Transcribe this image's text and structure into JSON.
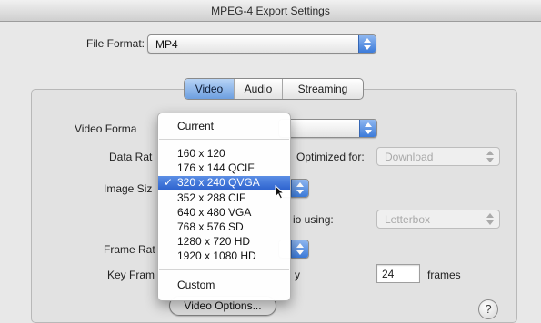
{
  "window": {
    "title": "MPEG-4 Export Settings"
  },
  "file_format": {
    "label": "File Format:",
    "value": "MP4"
  },
  "tabs": [
    {
      "label": "Video",
      "selected": true
    },
    {
      "label": "Audio",
      "selected": false
    },
    {
      "label": "Streaming",
      "selected": false
    }
  ],
  "video": {
    "format_label": "Video Forma",
    "data_rate_label": "Data Rat",
    "optimized_label": "Optimized for:",
    "optimized_value": "Download",
    "image_size_label": "Image Siz",
    "preserve_label": "io using:",
    "preserve_value": "Letterbox",
    "frame_rate_label": "Frame Rat",
    "key_frame_label": "Key Fram",
    "key_frame_suffix": "y",
    "key_frame_value": "24",
    "key_frame_units": "frames",
    "options_button": "Video Options...",
    "help_glyph": "?"
  },
  "menu": {
    "items": [
      {
        "label": "Current",
        "selected": false
      },
      {
        "label": "160 x 120",
        "selected": false
      },
      {
        "label": "176 x 144 QCIF",
        "selected": false
      },
      {
        "label": "320 x 240 QVGA",
        "selected": true
      },
      {
        "label": "352 x 288 CIF",
        "selected": false
      },
      {
        "label": "640 x 480 VGA",
        "selected": false
      },
      {
        "label": "768 x 576 SD",
        "selected": false
      },
      {
        "label": "1280 x 720 HD",
        "selected": false
      },
      {
        "label": "1920 x 1080 HD",
        "selected": false
      },
      {
        "label": "Custom",
        "selected": false
      }
    ],
    "check_glyph": "✓"
  },
  "colors": {
    "accent": "#3b7ad9",
    "menu_highlight": "#2f64cf",
    "window_bg": "#e8e8e8"
  }
}
